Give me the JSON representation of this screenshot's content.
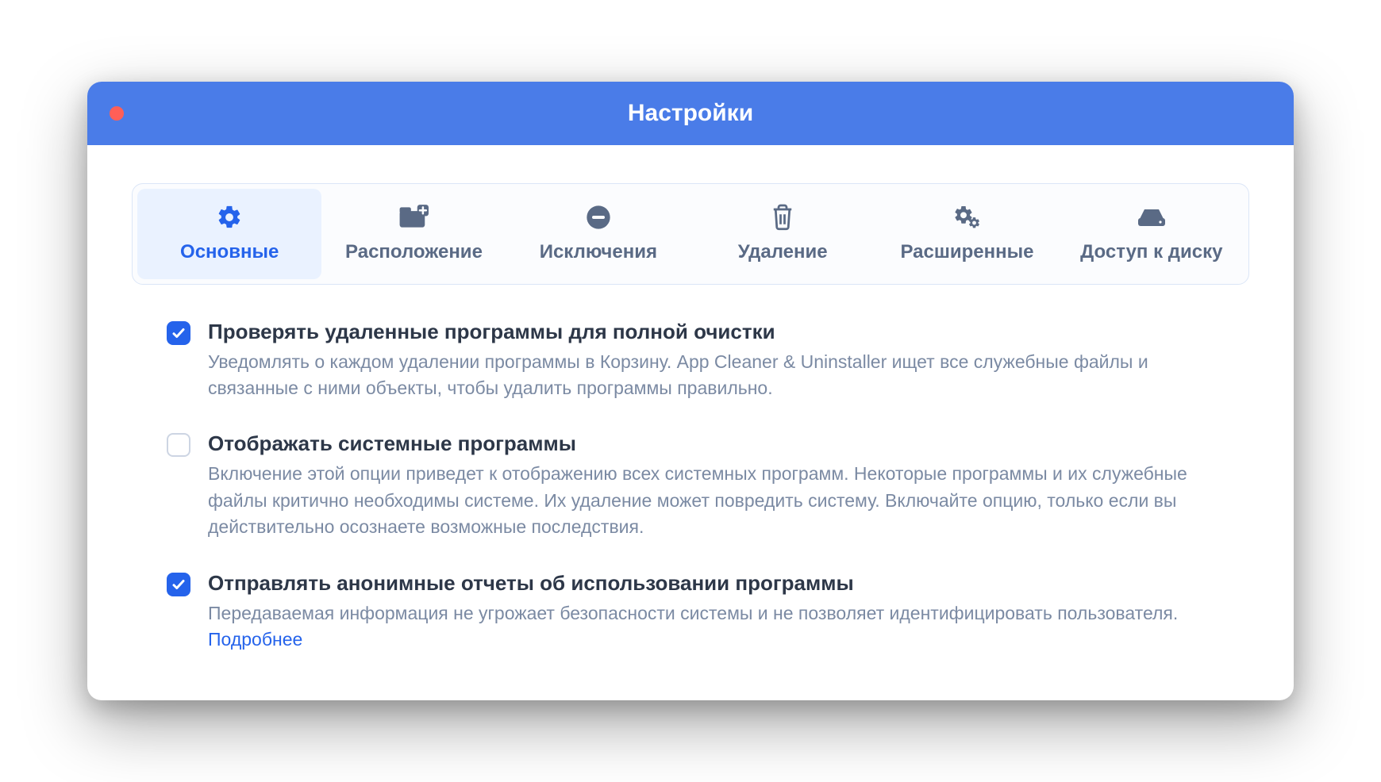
{
  "window": {
    "title": "Настройки"
  },
  "tabs": {
    "general": "Основные",
    "location": "Расположение",
    "exclusions": "Исключения",
    "removal": "Удаление",
    "advanced": "Расширенные",
    "disk_access": "Доступ к диску"
  },
  "options": {
    "check_removed": {
      "title": "Проверять удаленные программы для полной очистки",
      "desc": "Уведомлять о каждом удалении программы в Корзину. App Cleaner & Uninstaller ищет все служебные файлы и связанные с ними объекты, чтобы удалить программы правильно.",
      "checked": true
    },
    "show_system": {
      "title": "Отображать системные программы",
      "desc": "Включение этой опции приведет к отображению всех системных программ. Некоторые программы и их служебные файлы критично необходимы системе. Их удаление может повредить систему. Включайте опцию, только если вы действительно осознаете возможные последствия.",
      "checked": false
    },
    "send_reports": {
      "title": "Отправлять анонимные отчеты об использовании программы",
      "desc_prefix": "Передаваемая информация не угрожает безопасности системы и не позволяет идентифицировать пользователя. ",
      "link": "Подробнее",
      "checked": true
    }
  },
  "colors": {
    "accent": "#2563eb",
    "titlebar": "#4a7ce8",
    "text_primary": "#2d3748",
    "text_secondary": "#7b8aa3"
  }
}
